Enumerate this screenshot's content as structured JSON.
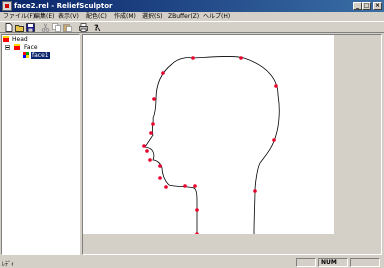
{
  "window": {
    "title": "face2.rel - ReliefSculptor",
    "minimize": "_",
    "maximize": "□",
    "close": "×"
  },
  "menu": [
    {
      "label": "ファイル(F)"
    },
    {
      "label": "編集(E)"
    },
    {
      "label": "表示(V)"
    },
    {
      "label": "配色(C)"
    },
    {
      "label": "作成(M)"
    },
    {
      "label": "選択(S)"
    },
    {
      "label": "ZBuffer(Z)"
    },
    {
      "label": "ヘルプ(H)"
    }
  ],
  "toolbar": {
    "icons": [
      "new-icon",
      "open-icon",
      "save-icon",
      "cut-icon",
      "copy-icon",
      "paste-icon",
      "print-icon",
      "help-icon"
    ]
  },
  "tree": {
    "items": [
      {
        "label": "Head",
        "icon": "red-node-icon",
        "color": "#ff0000"
      },
      {
        "label": "Face",
        "icon": "red-node-icon",
        "color": "#ff0000"
      },
      {
        "label": "face1",
        "icon": "colored-node-icon",
        "selected": true
      }
    ]
  },
  "status": {
    "text": "ﾚﾃﾞｨ",
    "num": "NUM"
  },
  "colors": {
    "titlebar_start": "#0a246a",
    "titlebar_end": "#3a6ea5",
    "control_point": "#e8002a",
    "selection": "#0a246a"
  }
}
